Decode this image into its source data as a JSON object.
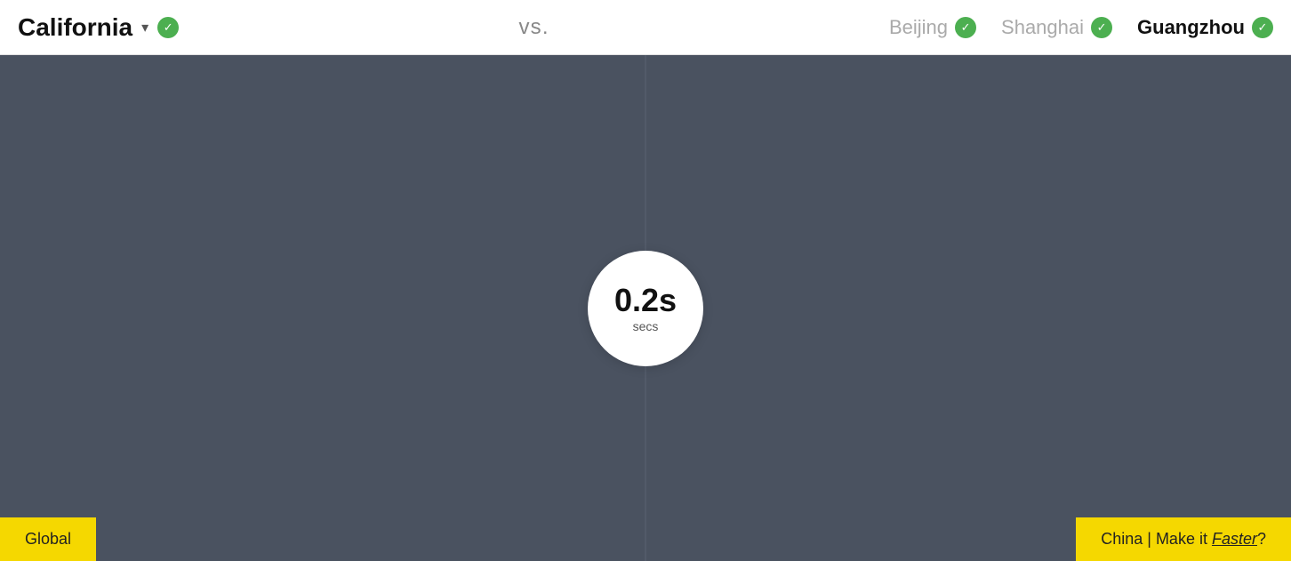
{
  "header": {
    "title": "California",
    "dropdown_label": "▾",
    "vs_label": "vs.",
    "locations": [
      {
        "id": "beijing",
        "label": "Beijing",
        "active": false
      },
      {
        "id": "shanghai",
        "label": "Shanghai",
        "active": false
      },
      {
        "id": "guangzhou",
        "label": "Guangzhou",
        "active": true
      }
    ],
    "check_symbol": "✓"
  },
  "main": {
    "timer_value": "0.2s",
    "timer_unit": "secs",
    "badge_left": "Global",
    "badge_right_prefix": "China | Make it ",
    "badge_right_link": "Faster",
    "badge_right_suffix": "?"
  }
}
